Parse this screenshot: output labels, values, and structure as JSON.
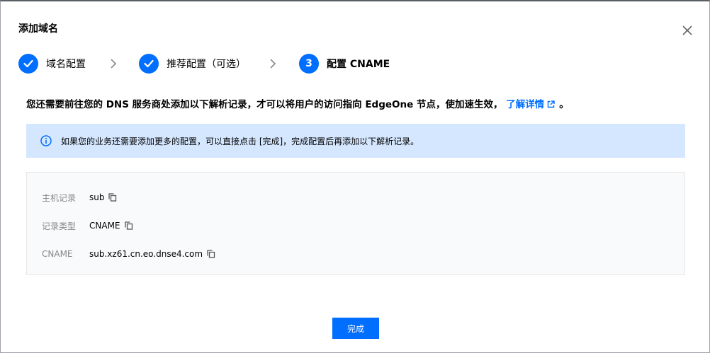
{
  "dialog": {
    "title": "添加域名"
  },
  "steps": [
    {
      "label": "域名配置",
      "status": "done",
      "icon": "check-icon"
    },
    {
      "label": "推荐配置（可选）",
      "status": "done",
      "icon": "check-icon"
    },
    {
      "label": "配置 CNAME",
      "status": "current",
      "number": "3"
    }
  ],
  "description": {
    "text": "您还需要前往您的 DNS 服务商处添加以下解析记录，才可以将用户的访问指向 EdgeOne 节点，使加速生效，",
    "link": "了解详情",
    "suffix": "。"
  },
  "alert": {
    "text": "如果您的业务还需要添加更多的配置，可以直接点击 [完成]，完成配置后再添加以下解析记录。"
  },
  "records": [
    {
      "label": "主机记录",
      "value": "sub"
    },
    {
      "label": "记录类型",
      "value": "CNAME"
    },
    {
      "label": "CNAME",
      "value": "sub.xz61.cn.eo.dnse4.com"
    }
  ],
  "footer": {
    "done_label": "完成"
  },
  "colors": {
    "primary": "#006eff",
    "alert_bg": "#d5e7ff",
    "records_bg": "#f9fafb"
  }
}
